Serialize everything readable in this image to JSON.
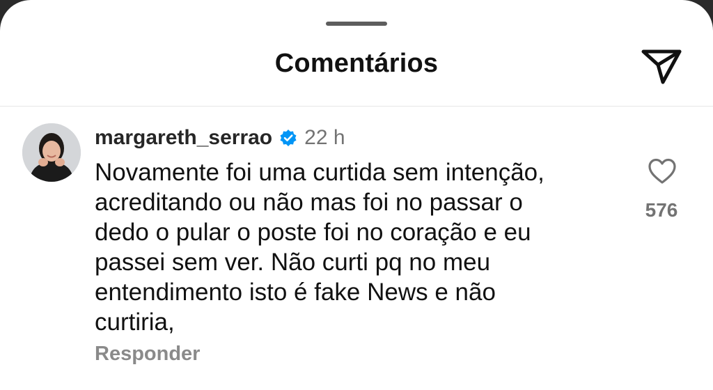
{
  "sheet": {
    "title": "Comentários",
    "share_icon": "send-icon"
  },
  "comment": {
    "username": "margareth_serrao",
    "verified_icon": "verified-badge-icon",
    "verified_color": "#0095f6",
    "time": "22 h",
    "lines": [
      "Novamente foi uma curtida sem intenção,",
      "acreditando ou não mas foi no passar o",
      "dedo o pular o poste foi no coração e eu",
      "passei sem ver. Não curti pq  no meu",
      "entendimento isto é fake News e não",
      "curtiria,"
    ],
    "like_icon": "heart-outline-icon",
    "like_count": "576",
    "reply_label": "Responder"
  }
}
